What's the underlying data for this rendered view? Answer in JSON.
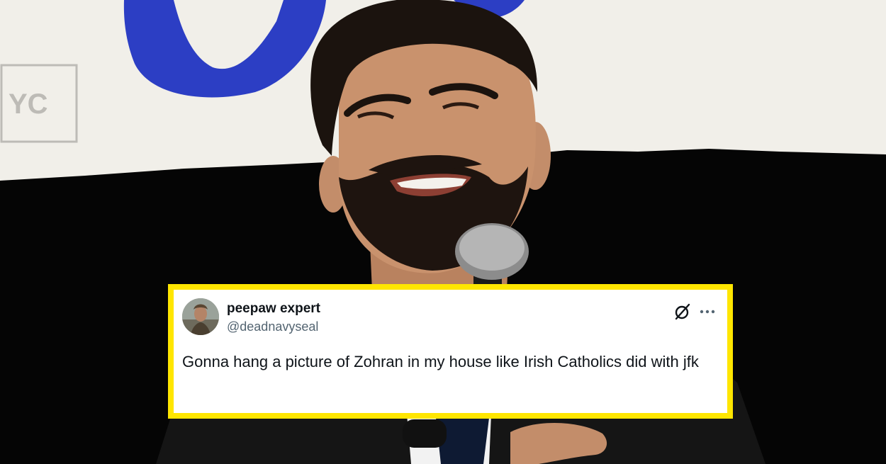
{
  "photo": {
    "banner_text": "YC"
  },
  "tweet": {
    "display_name": "peepaw expert",
    "handle": "@deadnavyseal",
    "text": "Gonna hang a picture of Zohran in my house like Irish Catholics did with jfk",
    "icons": [
      "grok-icon",
      "more-options-icon"
    ],
    "border_color": "#ffe600"
  }
}
